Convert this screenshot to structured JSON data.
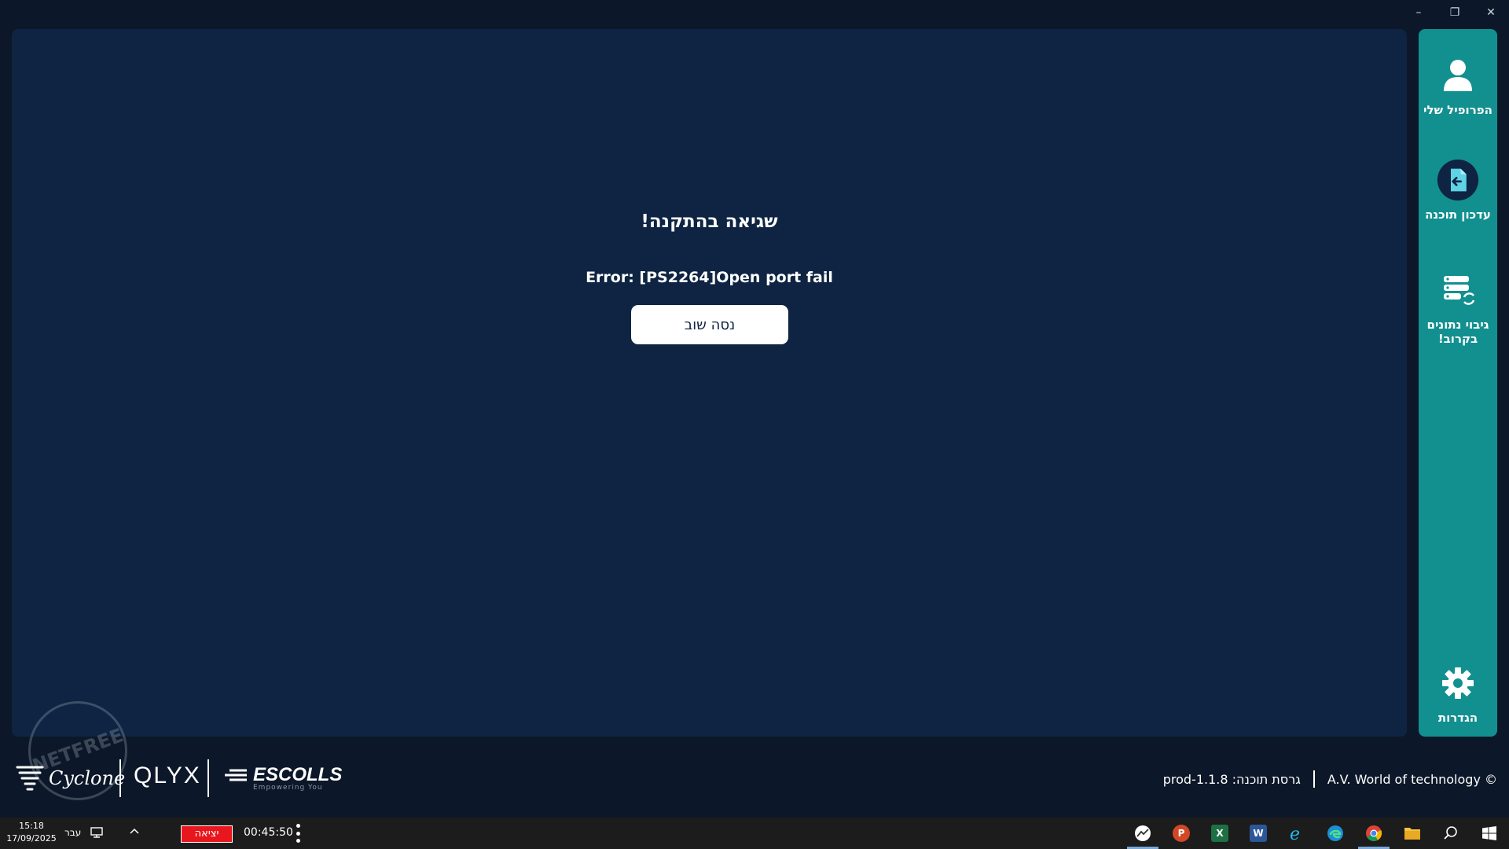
{
  "window": {
    "controls": {
      "minimize": "–",
      "maximize": "❐",
      "close": "✕"
    }
  },
  "main": {
    "error_title": "שגיאה בהתקנה!",
    "error_message": "Error: [PS2264]Open port fail",
    "retry_button": "נסה שוב"
  },
  "sidebar": {
    "items": [
      {
        "label": "הפרופיל שלי",
        "icon": "user-icon"
      },
      {
        "label": "עדכון תוכנה",
        "icon": "file-update-icon"
      },
      {
        "label": "גיבוי נתונים בקרוב!",
        "icon": "server-sync-icon"
      },
      {
        "label": "הגדרות",
        "icon": "gear-icon"
      }
    ]
  },
  "footer": {
    "logos": {
      "cyclone": "Cyclone",
      "qlyx": "QLYX",
      "escolls": "ESCOLLS",
      "escolls_tagline": "Empowering You"
    },
    "stamp_text": "NETFREE",
    "copyright": "A.V. World of technology ©",
    "version": "גרסת תוכנה: prod-1.1.8"
  },
  "taskbar": {
    "time": "15:18",
    "date": "17/09/2025",
    "language": "עבר",
    "exit_button": "יציאה",
    "timer": "00:45:50",
    "apps": [
      "chart-app-icon",
      "powerpoint-icon",
      "excel-icon",
      "word-icon",
      "internet-explorer-icon",
      "edge-icon",
      "chrome-icon",
      "file-explorer-icon",
      "search-icon",
      "windows-start-icon"
    ]
  },
  "colors": {
    "background": "#0c1829",
    "panel": "#0e2442",
    "sidebar": "#12908f",
    "exit_red": "#e8171d"
  }
}
